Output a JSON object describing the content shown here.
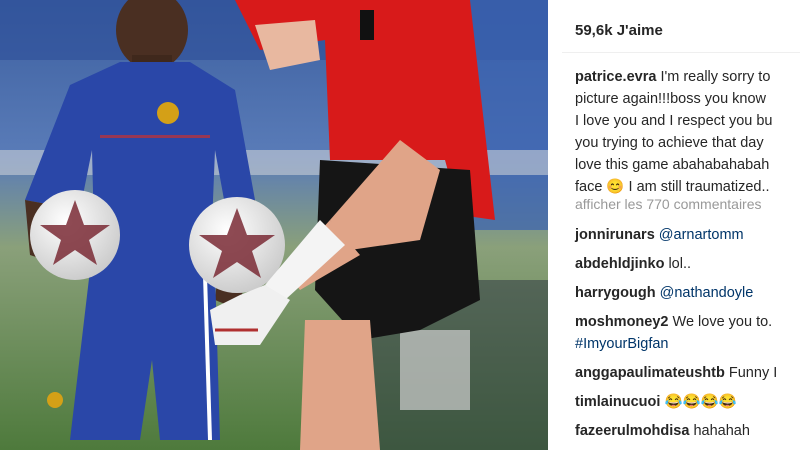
{
  "likes": {
    "count_label": "59,6k J'aime"
  },
  "caption": {
    "username": "patrice.evra",
    "lines": [
      "I'm really sorry to",
      "picture again!!!boss you know",
      "I love you and I respect you bu",
      "you trying to achieve that day",
      "love this game abahabahabah",
      "face 😊 I am still traumatized.."
    ]
  },
  "comments_link": "afficher les 770 commentaires",
  "comments": [
    {
      "user": "jonnirunars",
      "text": "@arnartomm",
      "is_tag": true
    },
    {
      "user": "abdehldjinko",
      "text": "lol..",
      "is_tag": false
    },
    {
      "user": "harrygough",
      "text": "@nathandoyle",
      "is_tag": true
    },
    {
      "user": "moshmoney2",
      "text": "We love you to.",
      "text2": "#ImyourBigfan",
      "is_tag": false
    },
    {
      "user": "anggapaulimateushtb",
      "text": "Funny I",
      "is_tag": false
    },
    {
      "user": "timlainucuoi",
      "text": "😂😂😂😂",
      "is_tag": false
    },
    {
      "user": "fazeerulmohdisa",
      "text": "hahahah",
      "is_tag": false
    }
  ],
  "colors": {
    "text": "#262626",
    "muted": "#999999",
    "link": "#003569",
    "jersey_blue": "#2a47a8",
    "jersey_red": "#d81a1a"
  }
}
